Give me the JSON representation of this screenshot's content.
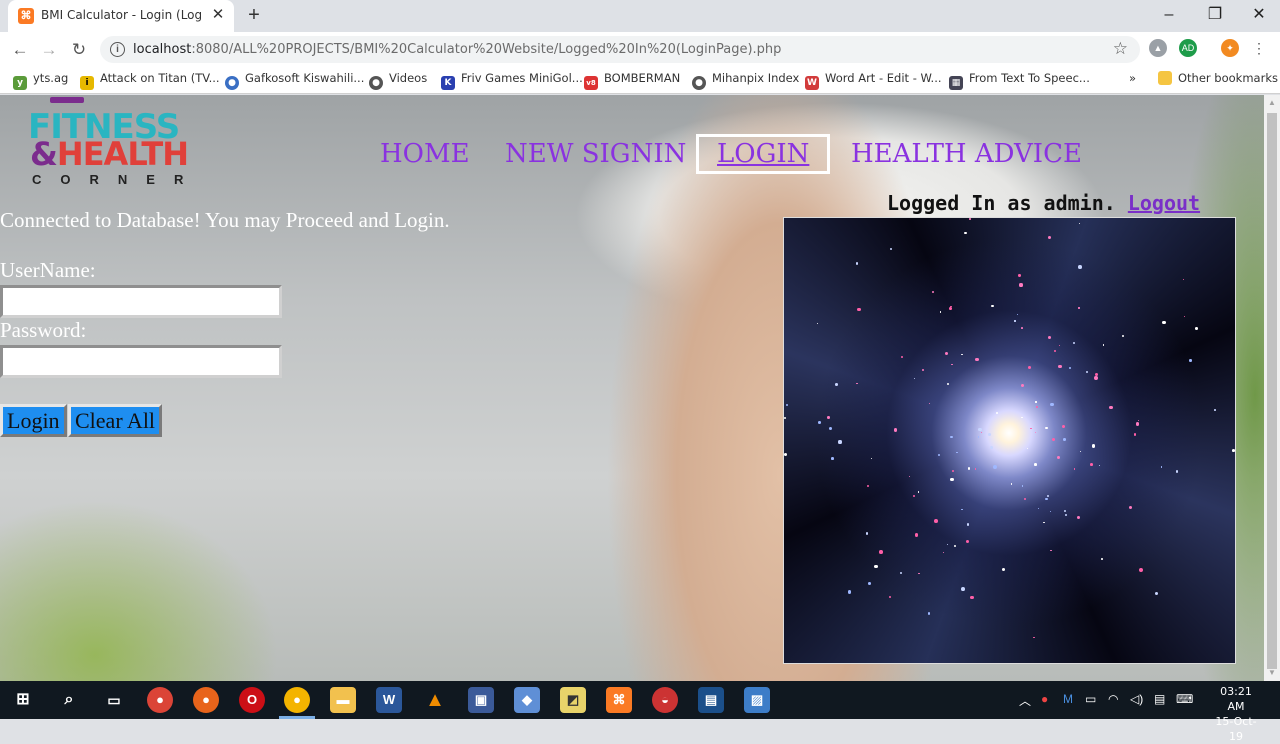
{
  "browser": {
    "tab_title": "BMI Calculator - Login (Logged In",
    "url_host": "localhost",
    "url_path": ":8080/ALL%20PROJECTS/BMI%20Calculator%20Website/Logged%20In%20(LoginPage).php",
    "bookmarks": [
      "yts.ag",
      "Attack on Titan (TV...",
      "Gafkosoft Kiswahili...",
      "Videos",
      "Friv Games MiniGol...",
      "BOMBERMAN",
      "Mihanpix Index",
      "Word Art - Edit - W...",
      "From Text To Speec..."
    ],
    "other_bookmarks": "Other bookmarks",
    "overflow": "»"
  },
  "logo": {
    "line1": "FITNESS",
    "line2_amp": "&",
    "line2_word": "HEALTH",
    "line3": "CORNER"
  },
  "nav": {
    "home": "HOME",
    "new_signin": "NEW SIGNIN",
    "login": "LOGIN",
    "health_advice": "HEALTH ADVICE"
  },
  "page": {
    "status_message": "Connected to Database! You may Proceed and Login.",
    "username_label": "UserName:",
    "password_label": "Password:",
    "login_button": "Login",
    "clear_button": "Clear All",
    "logged_in_text": "Logged In as admin.",
    "logout_link": "Logout"
  },
  "taskbar": {
    "time": "03:21 AM",
    "date": "15-Oct-19"
  }
}
